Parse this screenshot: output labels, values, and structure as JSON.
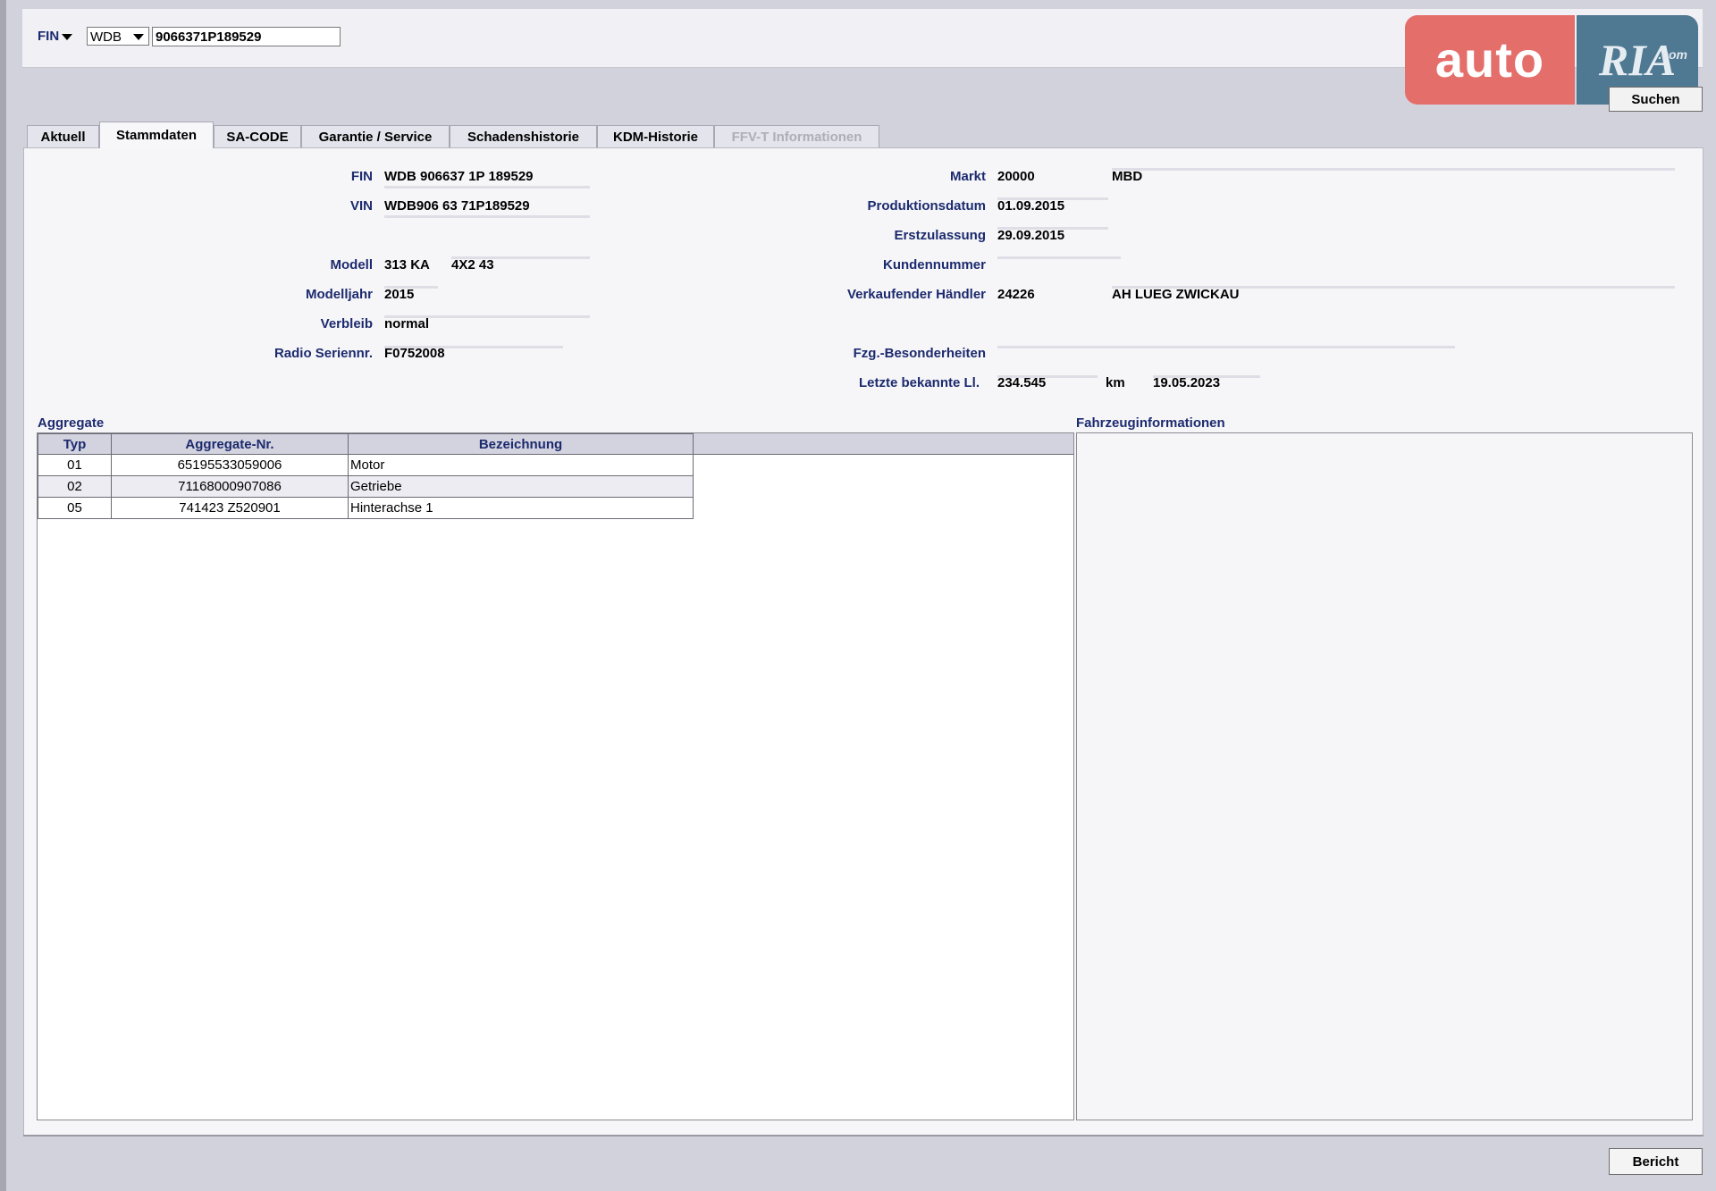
{
  "search": {
    "mode_label": "FIN",
    "prefix_value": "WDB",
    "fin_value": "9066371P189529",
    "button_label": "Suchen"
  },
  "logo": {
    "part1": "auto",
    "part2": "RIA",
    "part3": ".com"
  },
  "tabs": [
    {
      "label": "Aktuell",
      "state": "normal"
    },
    {
      "label": "Stammdaten",
      "state": "active"
    },
    {
      "label": "SA-CODE",
      "state": "normal"
    },
    {
      "label": "Garantie / Service",
      "state": "normal"
    },
    {
      "label": "Schadenshistorie",
      "state": "normal"
    },
    {
      "label": "KDM-Historie",
      "state": "normal"
    },
    {
      "label": "FFV-T Informationen",
      "state": "disabled"
    }
  ],
  "left_fields": {
    "fin": {
      "label": "FIN",
      "value": "WDB 906637 1P 189529"
    },
    "vin": {
      "label": "VIN",
      "value": "WDB906 63 71P189529"
    },
    "modell": {
      "label": "Modell",
      "value": "313 KA",
      "value2": "4X2 43"
    },
    "modelljahr": {
      "label": "Modelljahr",
      "value": "2015"
    },
    "verbleib": {
      "label": "Verbleib",
      "value": "normal"
    },
    "radio": {
      "label": "Radio Seriennr.",
      "value": "F0752008"
    }
  },
  "right_fields": {
    "markt": {
      "label": "Markt",
      "value": "20000",
      "value2": "MBD"
    },
    "produktionsdatum": {
      "label": "Produktionsdatum",
      "value": "01.09.2015"
    },
    "erstzulassung": {
      "label": "Erstzulassung",
      "value": "29.09.2015"
    },
    "kundennummer": {
      "label": "Kundennummer",
      "value": ""
    },
    "haendler": {
      "label": "Verkaufender Händler",
      "value": "24226",
      "value2": "AH LUEG ZWICKAU"
    },
    "besonderheiten": {
      "label": "Fzg.-Besonderheiten",
      "value": ""
    },
    "laufleistung": {
      "label": "Letzte bekannte Ll.",
      "value": "234.545",
      "unit": "km",
      "date": "19.05.2023"
    }
  },
  "aggregate": {
    "title": "Aggregate",
    "columns": [
      "Typ",
      "Aggregate-Nr.",
      "Bezeichnung"
    ],
    "rows": [
      [
        "01",
        "65195533059006",
        "Motor"
      ],
      [
        "02",
        "71168000907086",
        "Getriebe"
      ],
      [
        "05",
        "741423 Z520901",
        "Hinterachse 1"
      ]
    ]
  },
  "fahrzeuginfo": {
    "title": "Fahrzeuginformationen"
  },
  "footer": {
    "report_button": "Bericht"
  }
}
